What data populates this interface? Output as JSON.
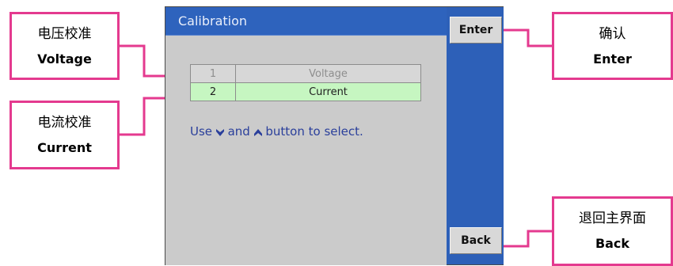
{
  "screen": {
    "title": "Calibration",
    "menu_rows": [
      {
        "index": "1",
        "label": "Voltage",
        "state": "disabled"
      },
      {
        "index": "2",
        "label": "Current",
        "state": "selected"
      }
    ],
    "hint": {
      "prefix": "Use",
      "middle": "and",
      "suffix": "button to select."
    }
  },
  "softkeys": {
    "enter": "Enter",
    "back": "Back"
  },
  "callouts": {
    "voltage": {
      "zh": "电压校准",
      "en": "Voltage"
    },
    "current": {
      "zh": "电流校准",
      "en": "Current"
    },
    "enter": {
      "zh": "确认",
      "en": "Enter"
    },
    "back": {
      "zh": "退回主界面",
      "en": "Back"
    }
  },
  "colors": {
    "callout_border": "#e43a8f",
    "screen_blue": "#2d60b8",
    "selected_row": "#c6f6c1",
    "hint_text": "#2a3f9b"
  }
}
